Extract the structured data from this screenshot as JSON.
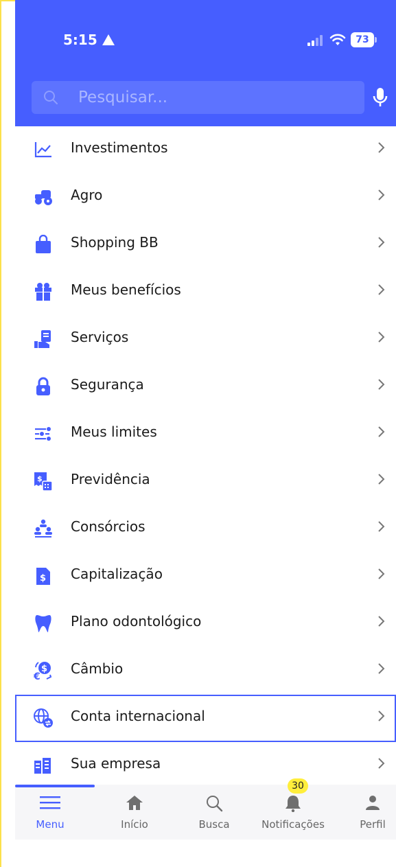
{
  "status_bar": {
    "time": "5:15",
    "battery": "73"
  },
  "search": {
    "placeholder": "Pesquisar..."
  },
  "menu": {
    "items": [
      {
        "label": "Investimentos",
        "icon": "chart-line-icon"
      },
      {
        "label": "Agro",
        "icon": "tractor-icon"
      },
      {
        "label": "Shopping BB",
        "icon": "shopping-bag-icon"
      },
      {
        "label": "Meus benefícios",
        "icon": "gift-icon"
      },
      {
        "label": "Serviços",
        "icon": "hand-document-icon"
      },
      {
        "label": "Segurança",
        "icon": "lock-icon"
      },
      {
        "label": "Meus limites",
        "icon": "sliders-icon"
      },
      {
        "label": "Previdência",
        "icon": "receipt-calculator-icon"
      },
      {
        "label": "Consórcios",
        "icon": "people-group-icon"
      },
      {
        "label": "Capitalização",
        "icon": "dollar-document-icon"
      },
      {
        "label": "Plano odontológico",
        "icon": "tooth-icon"
      },
      {
        "label": "Câmbio",
        "icon": "currency-exchange-icon"
      },
      {
        "label": "Conta internacional",
        "icon": "globe-exchange-icon"
      },
      {
        "label": "Sua empresa",
        "icon": "buildings-icon"
      }
    ],
    "selected_index": 12
  },
  "bottom_nav": {
    "items": [
      {
        "label": "Menu",
        "icon": "hamburger-menu-icon",
        "active": true
      },
      {
        "label": "Início",
        "icon": "home-icon"
      },
      {
        "label": "Busca",
        "icon": "search-icon"
      },
      {
        "label": "Notificações",
        "icon": "bell-icon"
      },
      {
        "label": "Perfil",
        "icon": "person-icon"
      }
    ],
    "notifications_badge": "30"
  },
  "colors": {
    "brand_blue": "#465eff",
    "badge_yellow": "#ffee3c"
  }
}
